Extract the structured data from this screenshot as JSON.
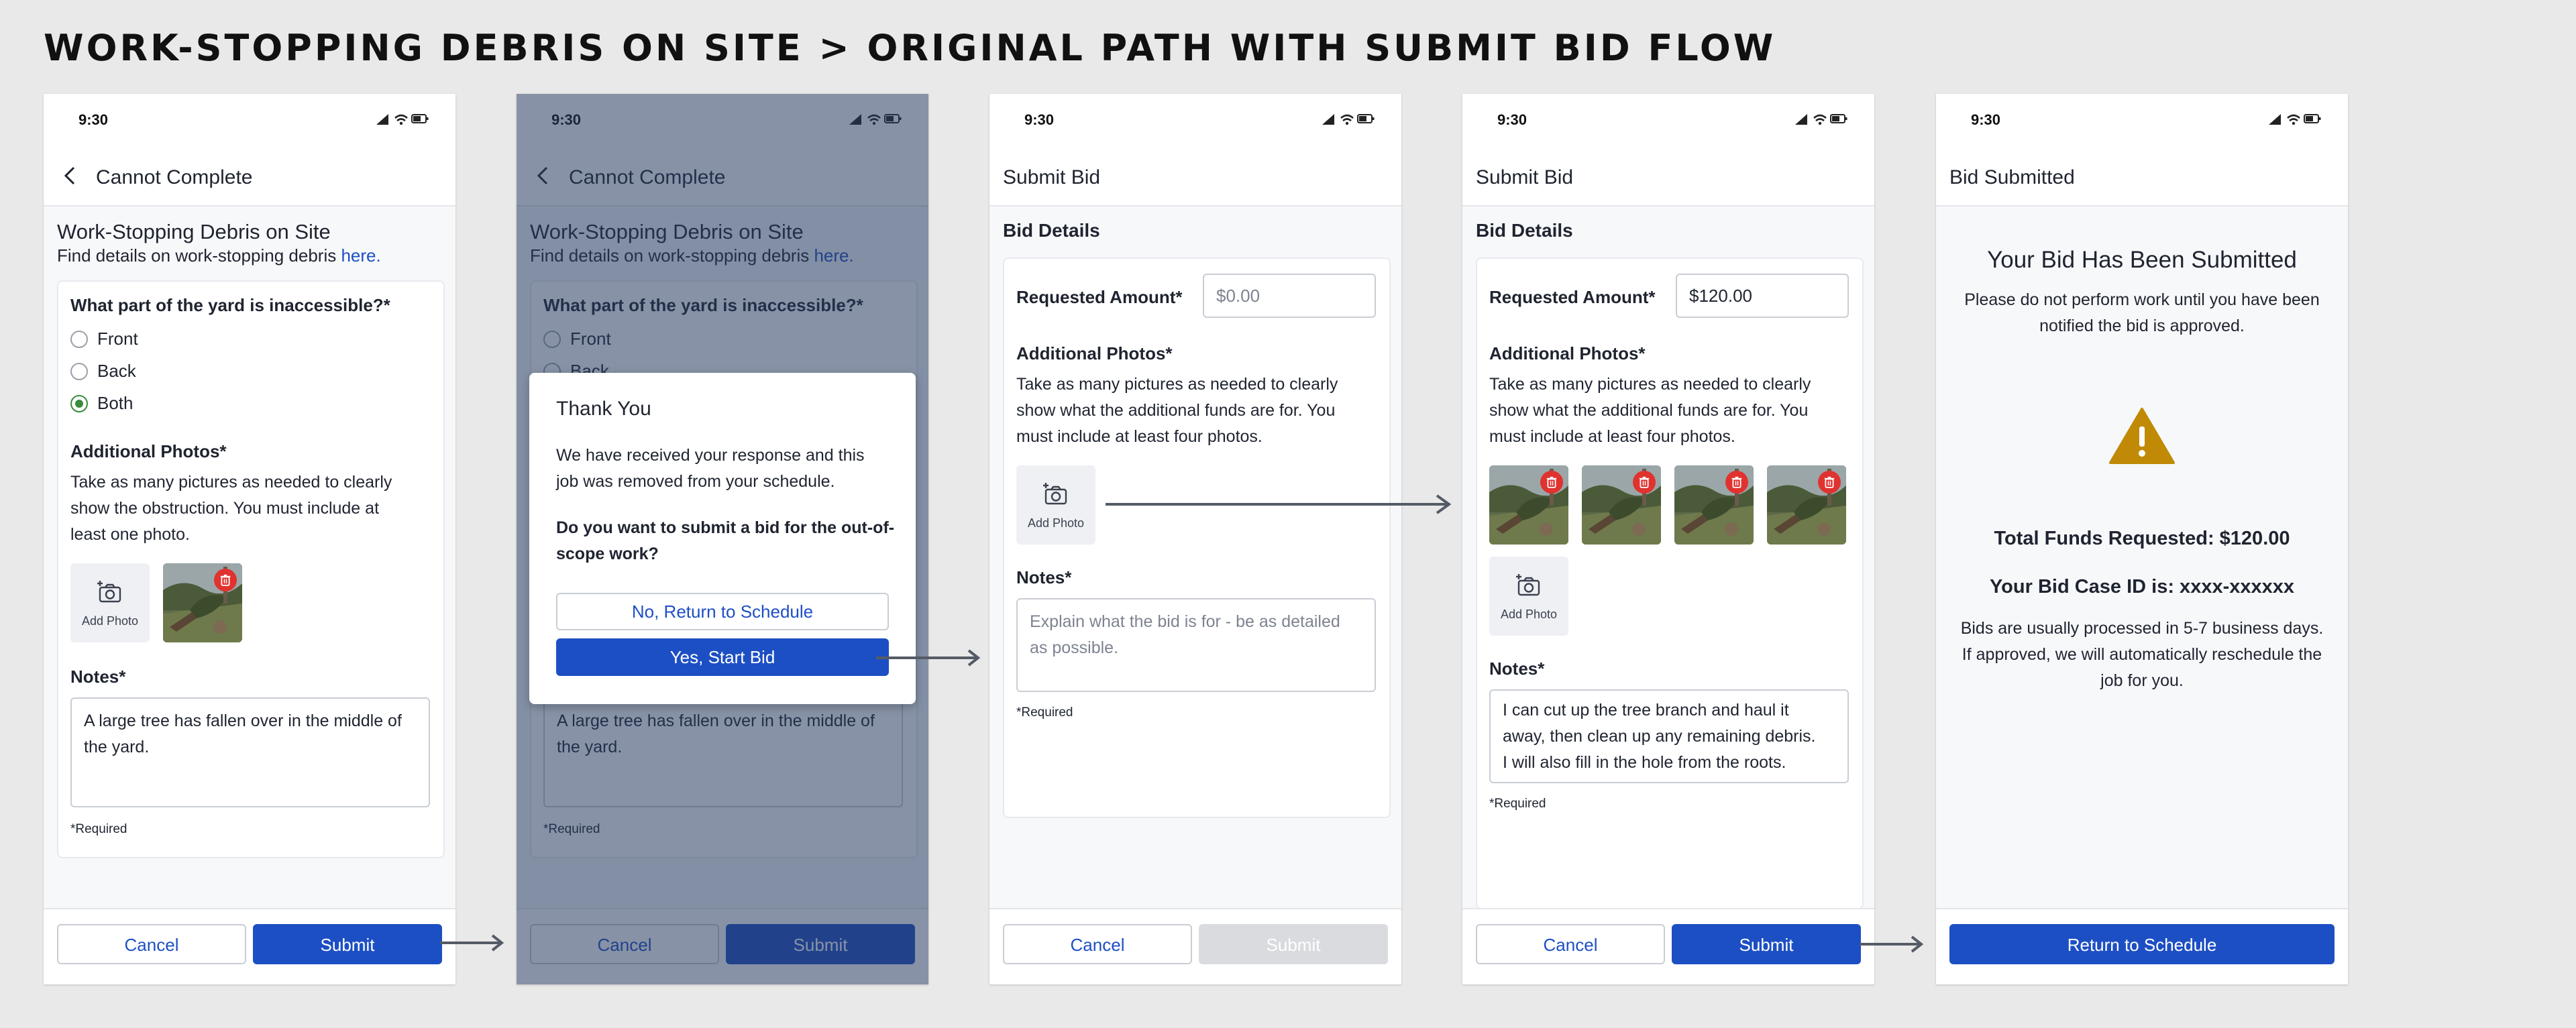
{
  "page_title": "WORK-STOPPING DEBRIS ON SITE > ORIGINAL PATH WITH SUBMIT BID FLOW",
  "status_time": "9:30",
  "screen1": {
    "nav_title": "Cannot Complete",
    "heading": "Work-Stopping Debris on Site",
    "subtext": "Find details on work-stopping debris ",
    "subtext_link": "here.",
    "question": "What part of the yard is inaccessible?*",
    "options": [
      "Front",
      "Back",
      "Both"
    ],
    "selected": "Both",
    "photos_label": "Additional Photos*",
    "photos_help_1": "Take as many pictures as needed to clearly",
    "photos_help_2": "show the obstruction. You must include at",
    "photos_help_3": "least one photo.",
    "add_photo": "Add Photo",
    "notes_label": "Notes*",
    "notes_1": "A large tree has fallen over in the middle of",
    "notes_2": "the yard.",
    "required": "*Required",
    "cancel": "Cancel",
    "submit": "Submit"
  },
  "screen2": {
    "modal_title": "Thank You",
    "modal_text_1": "We have received your response and this",
    "modal_text_2": "job was removed from your schedule.",
    "modal_question_1": "Do you want to submit a bid for the out-of-",
    "modal_question_2": "scope work?",
    "no_button": "No, Return to Schedule",
    "yes_button": "Yes, Start Bid"
  },
  "screen3": {
    "nav_title": "Submit Bid",
    "section": "Bid Details",
    "amount_label": "Requested Amount*",
    "amount_placeholder": "$0.00",
    "photos_label": "Additional Photos*",
    "photos_help_1": "Take as many pictures as needed to clearly",
    "photos_help_2": "show what the additional funds are for. You",
    "photos_help_3": "must include at least four photos.",
    "add_photo": "Add Photo",
    "notes_label": "Notes*",
    "notes_placeholder_1": "Explain what the bid is for - be as detailed",
    "notes_placeholder_2": "as possible.",
    "required": "*Required",
    "cancel": "Cancel",
    "submit": "Submit"
  },
  "screen4": {
    "nav_title": "Submit Bid",
    "section": "Bid Details",
    "amount_label": "Requested Amount*",
    "amount_value": "$120.00",
    "photos_label": "Additional Photos*",
    "photos_help_1": "Take as many pictures as needed to clearly",
    "photos_help_2": "show what the additional funds are for. You",
    "photos_help_3": "must include at least four photos.",
    "add_photo": "Add Photo",
    "notes_label": "Notes*",
    "notes_1": "I can cut up the tree branch and haul it",
    "notes_2": "away, then clean up any remaining debris.",
    "notes_3": "I will also fill in the hole from the roots.",
    "required": "*Required",
    "cancel": "Cancel",
    "submit": "Submit"
  },
  "screen5": {
    "nav_title": "Bid Submitted",
    "heading": "Your Bid Has Been Submitted",
    "sub_1": "Please do not perform work until you have been",
    "sub_2": "notified the bid is approved.",
    "total": "Total Funds Requested: $120.00",
    "case_id": "Your Bid Case ID is: xxxx-xxxxxx",
    "info_1": "Bids are usually processed in 5-7 business days.",
    "info_2": "If approved, we will automatically reschedule the",
    "info_3": "job for you.",
    "return_button": "Return to Schedule"
  },
  "colors": {
    "primary": "#1d4fc4",
    "selected_radio": "#3a8b3a",
    "delete": "#e0322f",
    "warning": "#c08a06"
  }
}
